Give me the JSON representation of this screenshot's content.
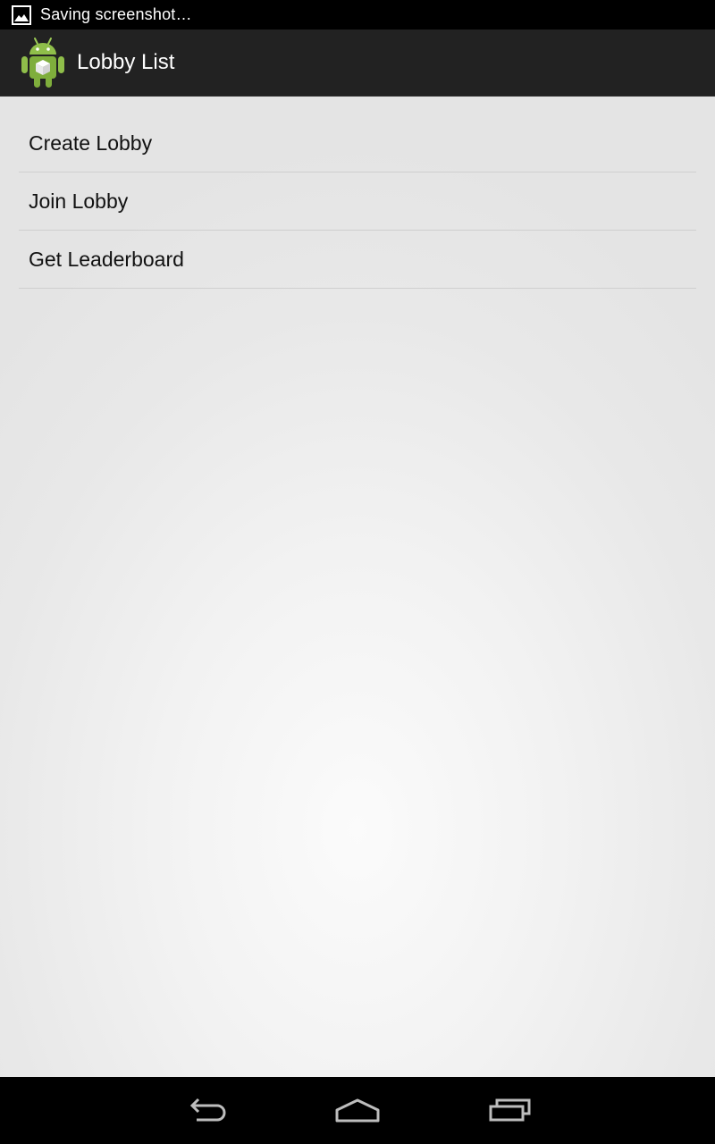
{
  "status_bar": {
    "notification_icon": "image-icon",
    "text": "Saving screenshot…"
  },
  "action_bar": {
    "app_icon": "android-icon",
    "title": "Lobby List"
  },
  "menu": {
    "items": [
      {
        "label": "Create Lobby"
      },
      {
        "label": "Join Lobby"
      },
      {
        "label": "Get Leaderboard"
      }
    ]
  },
  "nav_bar": {
    "buttons": [
      "back-icon",
      "home-icon",
      "recents-icon"
    ]
  },
  "colors": {
    "status_bar_bg": "#000000",
    "action_bar_bg": "#222222",
    "content_bg": "#e8e8e8",
    "android_green": "#8ab84a"
  }
}
